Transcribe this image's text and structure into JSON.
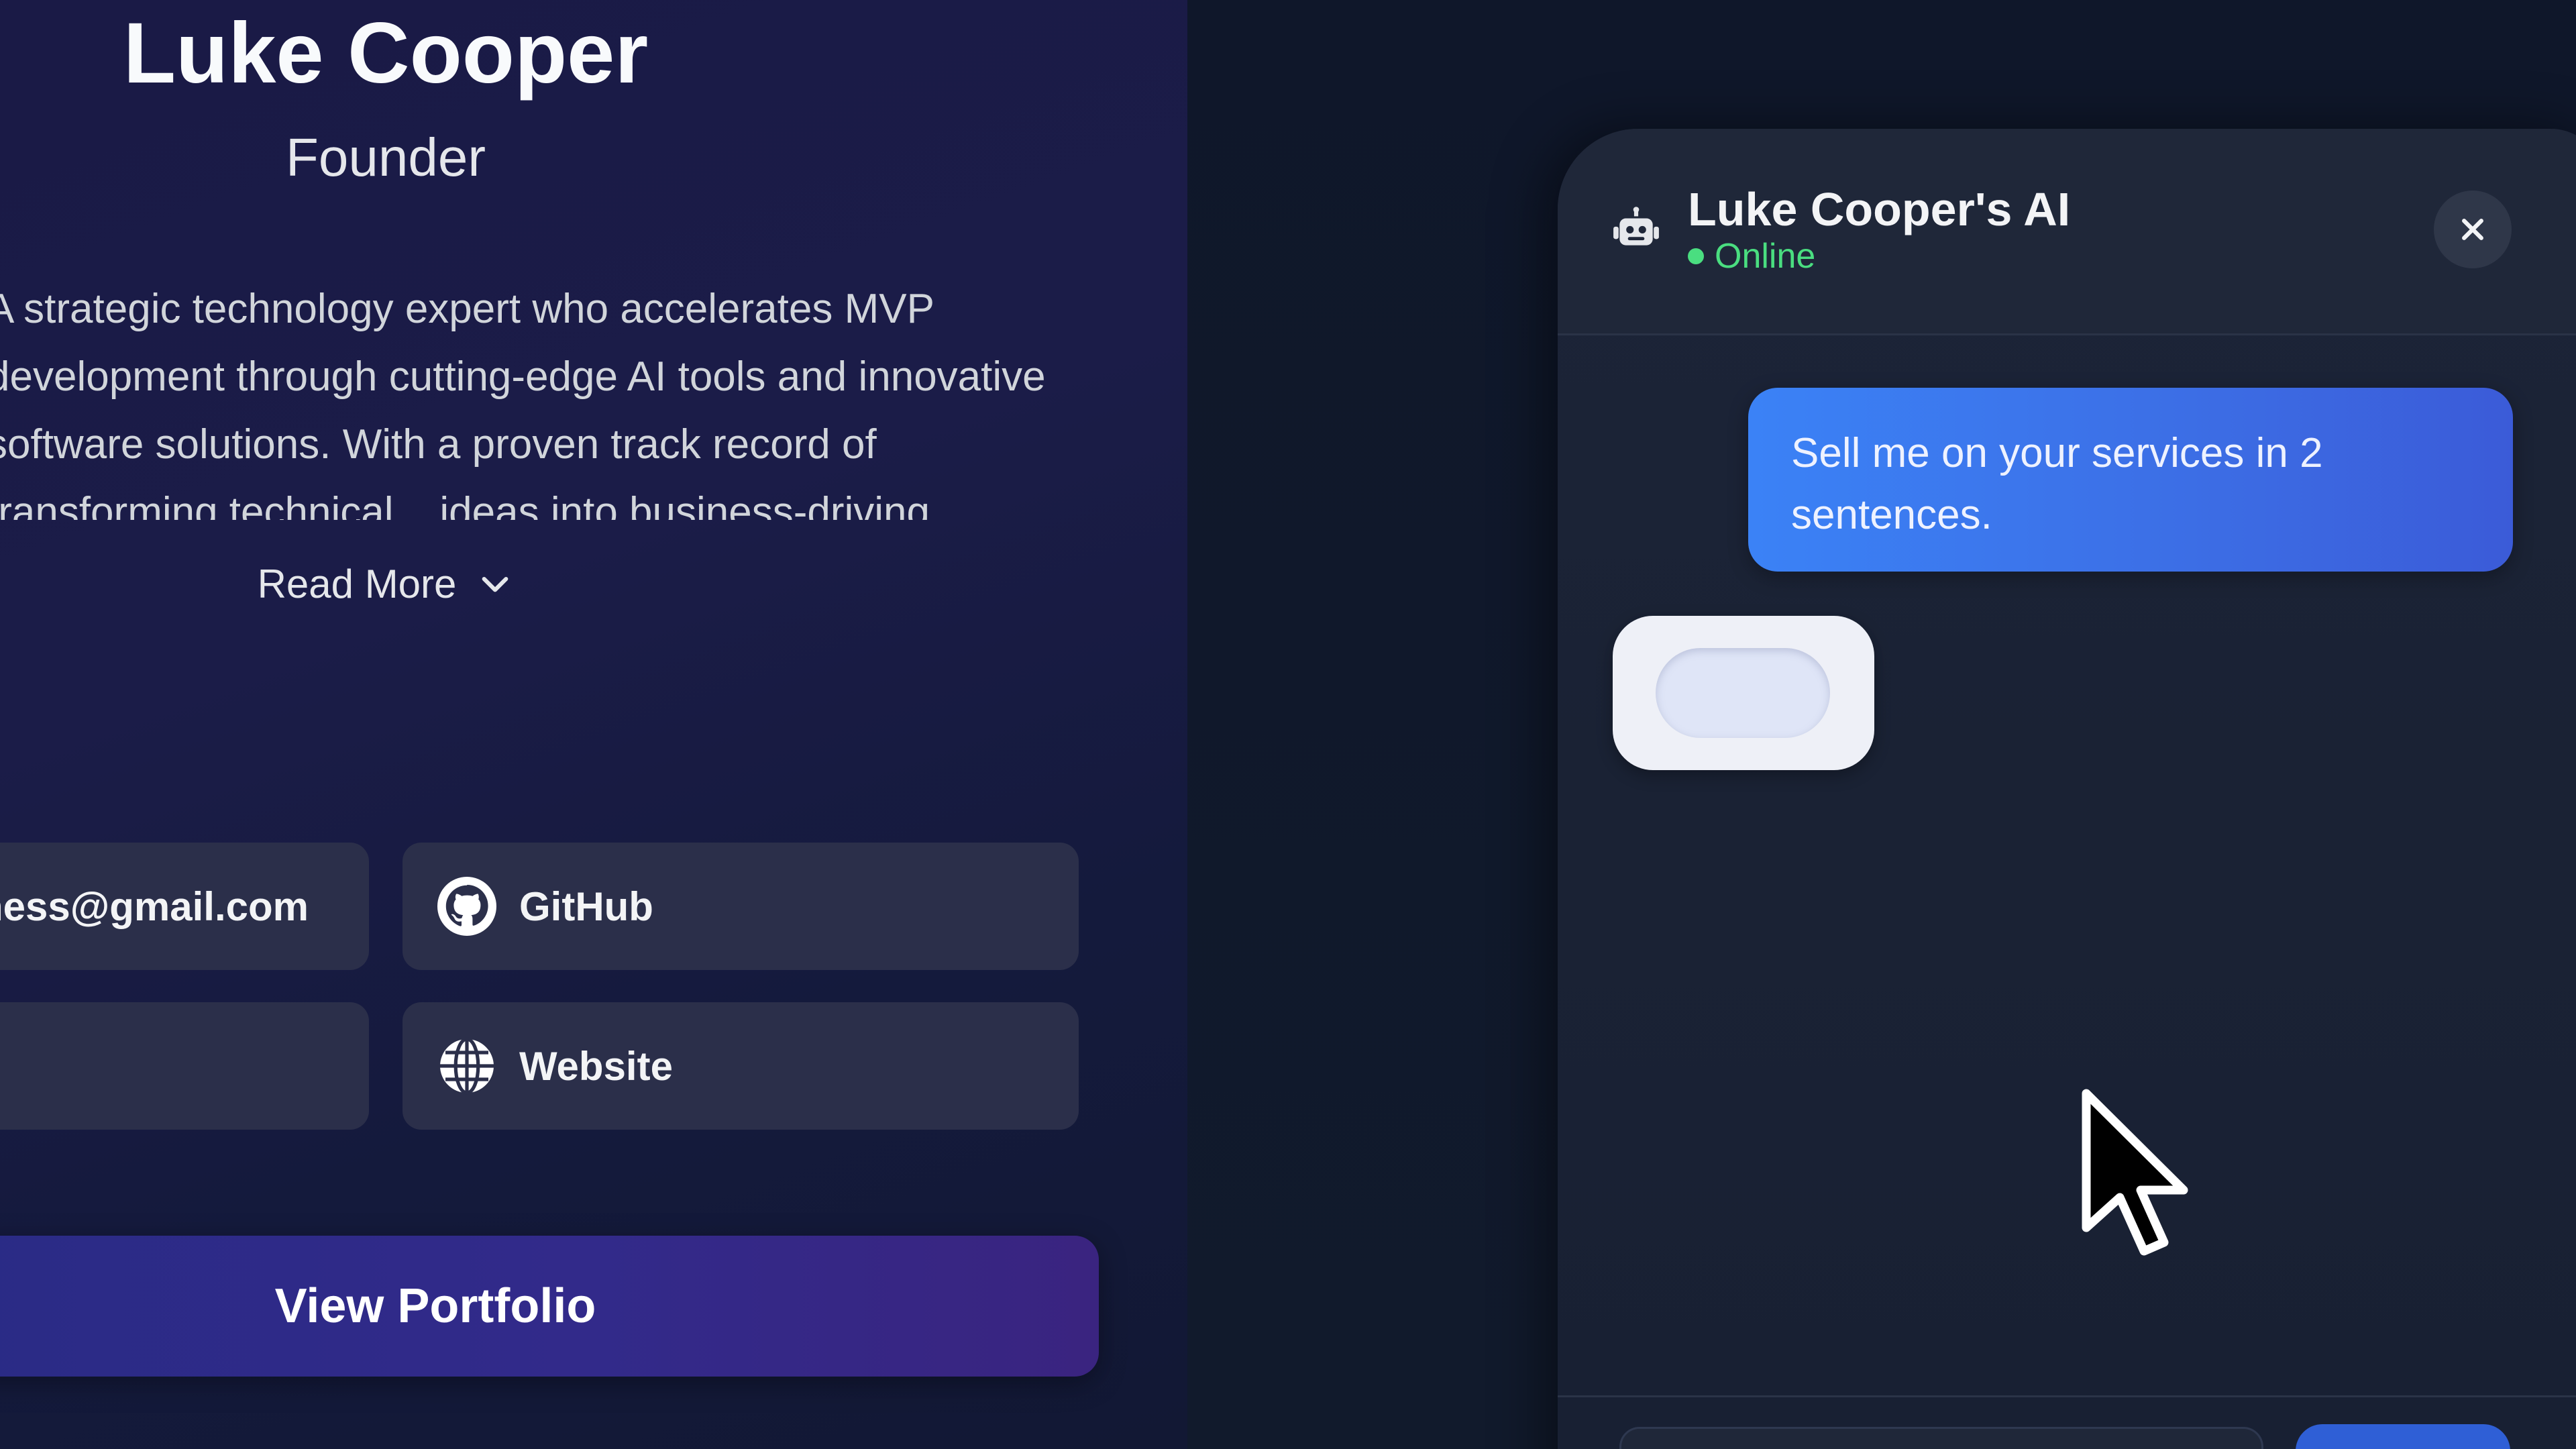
{
  "profile": {
    "name": "Luke Cooper",
    "role": "Founder",
    "bio": "A strategic technology expert who accelerates MVP development through cutting-edge AI tools and innovative software solutions. With a proven track record of transforming technical... ideas into business-driving results, he enables clients to launch",
    "read_more_label": "Read More",
    "links": {
      "email_label": "lukecooperbusiness@gmail.com",
      "github_label": "GitHub",
      "website_label": "Website"
    },
    "portfolio_label": "View Portfolio"
  },
  "chat": {
    "title": "Luke Cooper's AI",
    "status": "Online",
    "messages": [
      {
        "role": "user",
        "text": "Sell me on your services in 2 sentences."
      }
    ]
  },
  "colors": {
    "profile_bg": "#1b1c48",
    "accent_blue": "#3b82f6",
    "portfolio_gradient_start": "#2a2b86",
    "status_green": "#4ade80"
  },
  "icons": [
    "chevron-down-icon",
    "github-icon",
    "globe-icon",
    "robot-icon",
    "close-icon",
    "mouse-pointer-icon"
  ]
}
